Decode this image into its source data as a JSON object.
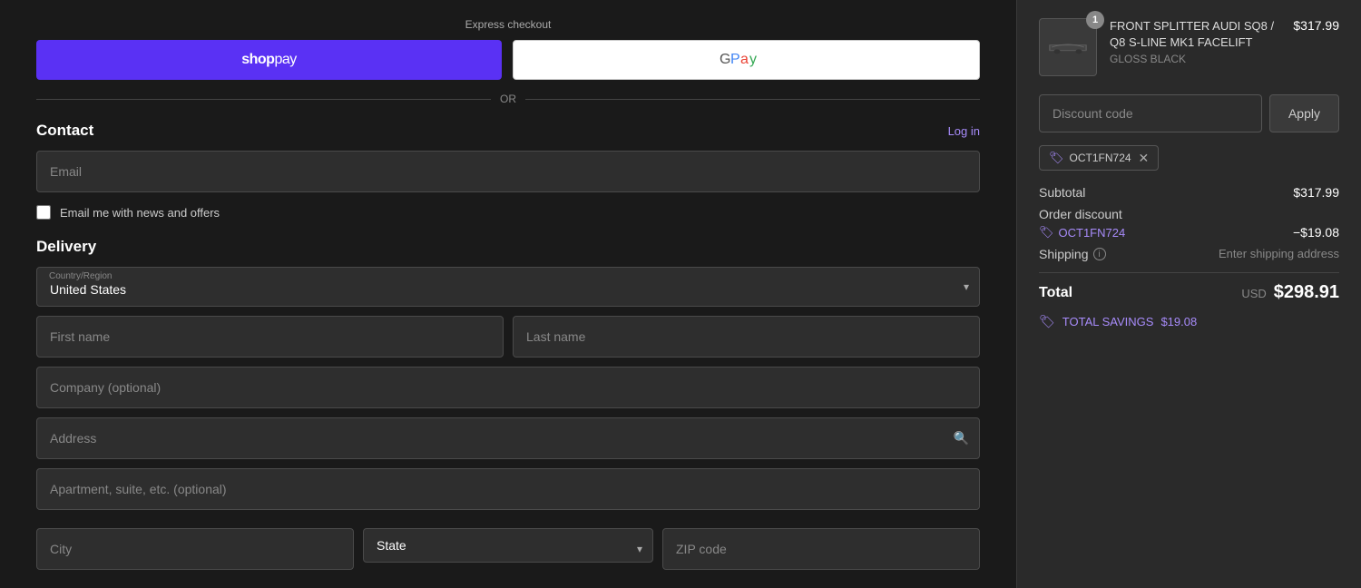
{
  "express": {
    "label": "Express checkout"
  },
  "or_divider": "OR",
  "contact": {
    "title": "Contact",
    "log_in_label": "Log in",
    "email_placeholder": "Email",
    "newsletter_label": "Email me with news and offers"
  },
  "delivery": {
    "title": "Delivery",
    "country_label": "Country/Region",
    "country_value": "United States",
    "first_name_placeholder": "First name",
    "last_name_placeholder": "Last name",
    "company_placeholder": "Company (optional)",
    "address_placeholder": "Address",
    "apartment_placeholder": "Apartment, suite, etc. (optional)",
    "city_placeholder": "City",
    "state_placeholder": "State",
    "zip_placeholder": "ZIP code"
  },
  "right_panel": {
    "product": {
      "image_alt": "Front Splitter Product",
      "quantity": "1",
      "name": "FRONT SPLITTER AUDI SQ8 / Q8 S-LINE MK1 FACELIFT",
      "variant": "GLOSS BLACK",
      "price": "$317.99"
    },
    "discount_placeholder": "Discount code",
    "apply_label": "Apply",
    "applied_coupon": "OCT1FN724",
    "subtotal_label": "Subtotal",
    "subtotal_value": "$317.99",
    "order_discount_label": "Order discount",
    "order_discount_code": "OCT1FN724",
    "order_discount_value": "−$19.08",
    "shipping_label": "Shipping",
    "shipping_value": "Enter shipping address",
    "total_label": "Total",
    "total_currency": "USD",
    "total_value": "$298.91",
    "savings_label": "TOTAL SAVINGS",
    "savings_value": "$19.08"
  }
}
